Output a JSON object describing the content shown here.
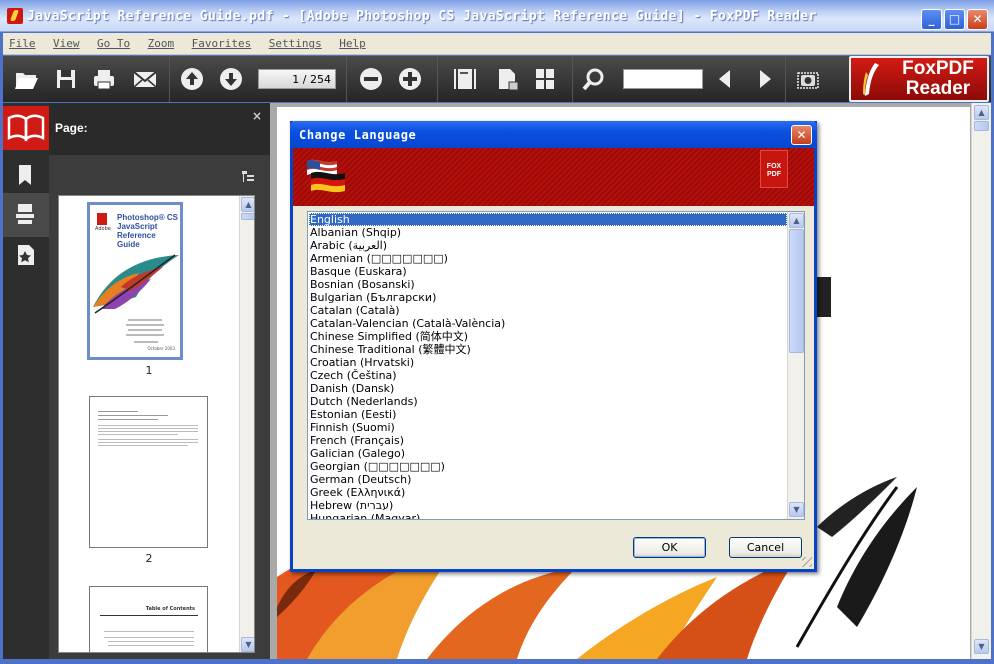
{
  "window": {
    "title": "JavaScript Reference Guide.pdf - [Adobe Photoshop CS JavaScript Reference Guide] - FoxPDF Reader",
    "controls": {
      "minimize": "_",
      "maximize": "□",
      "close": "✕"
    }
  },
  "menu": {
    "items": [
      "File",
      "View",
      "Go To",
      "Zoom",
      "Favorites",
      "Settings",
      "Help"
    ]
  },
  "toolbar": {
    "page_field": "1 / 254",
    "search_value": "",
    "icons": [
      "open-folder-icon",
      "save-icon",
      "print-icon",
      "email-icon",
      "page-up-icon",
      "page-down-icon",
      "zoom-out-icon",
      "zoom-in-icon",
      "fit-page-icon",
      "actual-size-icon",
      "thumbnail-layout-icon",
      "search-icon",
      "find-previous-icon",
      "find-next-icon",
      "snapshot-icon"
    ],
    "brand": {
      "line1": "FoxPDF",
      "line2": "Reader"
    }
  },
  "left_panel": {
    "title": "Page:",
    "close_glyph": "×",
    "tabs": [
      "book-icon",
      "bookmark-icon",
      "pages-icon",
      "favorites-icon"
    ],
    "thumbnails": [
      {
        "number": "1",
        "logo": "Adobe",
        "heading_lines": [
          "Photoshop® CS",
          "JavaScript",
          "Reference Guide"
        ],
        "footer_note": "October 2003"
      },
      {
        "number": "2"
      },
      {
        "number": "",
        "heading": "Table of Contents"
      }
    ]
  },
  "dialog": {
    "title": "Change Language",
    "close_glyph": "✕",
    "logo_text": "FOX PDF",
    "selected": "English",
    "languages": [
      "English",
      "Albanian (Shqip)",
      "Arabic (العربية)",
      "Armenian (□□□□□□□)",
      "Basque (Euskara)",
      "Bosnian (Bosanski)",
      "Bulgarian (Български)",
      "Catalan (Català)",
      "Catalan-Valencian (Català-València)",
      "Chinese Simplified (简体中文)",
      "Chinese Traditional (繁體中文)",
      "Croatian (Hrvatski)",
      "Czech (Čeština)",
      "Danish (Dansk)",
      "Dutch (Nederlands)",
      "Estonian (Eesti)",
      "Finnish (Suomi)",
      "French (Français)",
      "Galician (Galego)",
      "Georgian (□□□□□□□)",
      "German (Deutsch)",
      "Greek (Ελληνικά)",
      "Hebrew (עברית)",
      "Hungarian (Magyar)"
    ],
    "ok_label": "OK",
    "cancel_label": "Cancel"
  },
  "colors": {
    "accent_red": "#d01a14",
    "toolbar_dark": "#2b2b2b",
    "xp_blue": "#0843c5",
    "selection_blue": "#316ac5"
  }
}
